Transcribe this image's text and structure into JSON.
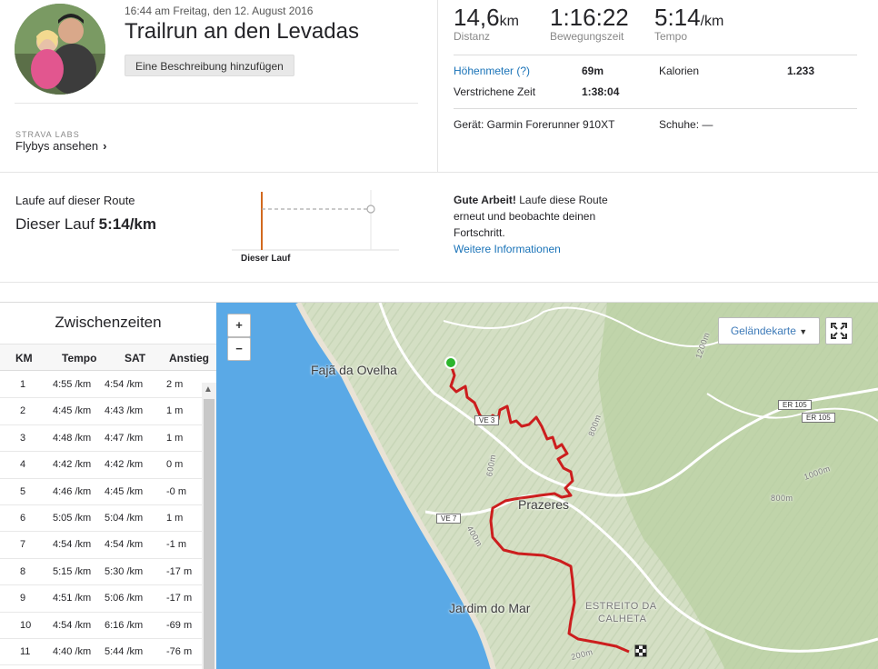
{
  "activity": {
    "datetime": "16:44 am Freitag, den 12. August 2016",
    "title": "Trailrun an den Levadas",
    "add_description": "Eine Beschreibung hinzufügen",
    "labs_label": "STRAVA LABS",
    "flybys_label": "Flybys ansehen"
  },
  "stats": {
    "distance": {
      "value": "14,6",
      "unit": "km",
      "label": "Distanz"
    },
    "moving_time": {
      "value": "1:16:22",
      "label": "Bewegungszeit"
    },
    "pace": {
      "value": "5:14",
      "unit": "/km",
      "label": "Tempo"
    },
    "elevation_label": "Höhenmeter (?)",
    "elevation_value": "69m",
    "calories_label": "Kalorien",
    "calories_value": "1.233",
    "elapsed_label": "Verstrichene Zeit",
    "elapsed_value": "1:38:04",
    "device": "Gerät: Garmin Forerunner 910XT",
    "shoes": "Schuhe: —"
  },
  "route": {
    "title": "Laufe auf dieser Route",
    "run_label": "Dieser Lauf",
    "run_pace": "5:14/km",
    "chart_label": "Dieser Lauf",
    "msg_bold": "Gute Arbeit!",
    "msg_text": " Laufe diese Route erneut und beobachte deinen Fortschritt.",
    "more_link": "Weitere Informationen"
  },
  "splits": {
    "title": "Zwischenzeiten",
    "headers": [
      "KM",
      "Tempo",
      "SAT",
      "Anstieg"
    ],
    "rows": [
      [
        "1",
        "4:55 /km",
        "4:54 /km",
        "2 m"
      ],
      [
        "2",
        "4:45 /km",
        "4:43 /km",
        "1 m"
      ],
      [
        "3",
        "4:48 /km",
        "4:47 /km",
        "1 m"
      ],
      [
        "4",
        "4:42 /km",
        "4:42 /km",
        "0 m"
      ],
      [
        "5",
        "4:46 /km",
        "4:45 /km",
        "-0 m"
      ],
      [
        "6",
        "5:05 /km",
        "5:04 /km",
        "1 m"
      ],
      [
        "7",
        "4:54 /km",
        "4:54 /km",
        "-1 m"
      ],
      [
        "8",
        "5:15 /km",
        "5:30 /km",
        "-17 m"
      ],
      [
        "9",
        "4:51 /km",
        "5:06 /km",
        "-17 m"
      ],
      [
        "10",
        "4:54 /km",
        "6:16 /km",
        "-69 m"
      ],
      [
        "11",
        "4:40 /km",
        "5:44 /km",
        "-76 m"
      ]
    ]
  },
  "map": {
    "zoom_in": "+",
    "zoom_out": "−",
    "layer_select": "Geländekarte",
    "places": {
      "faja": "Fajã da Ovelha",
      "prazeres": "Prazeres",
      "jardim": "Jardim do Mar",
      "estreito_1": "ESTREITO DA",
      "estreito_2": "CALHETA"
    },
    "roads": {
      "ve3": "VE 3",
      "ve7": "VE 7",
      "er105a": "ER 105",
      "er105b": "ER 105"
    },
    "contours": {
      "c1200": "1200m",
      "c800a": "800m",
      "c600": "600m",
      "c1000": "1000m",
      "c800b": "800m",
      "c400": "400m",
      "c200": "200m"
    },
    "route_color": "#cc1e1e",
    "sea_color": "#5aa9e6"
  }
}
